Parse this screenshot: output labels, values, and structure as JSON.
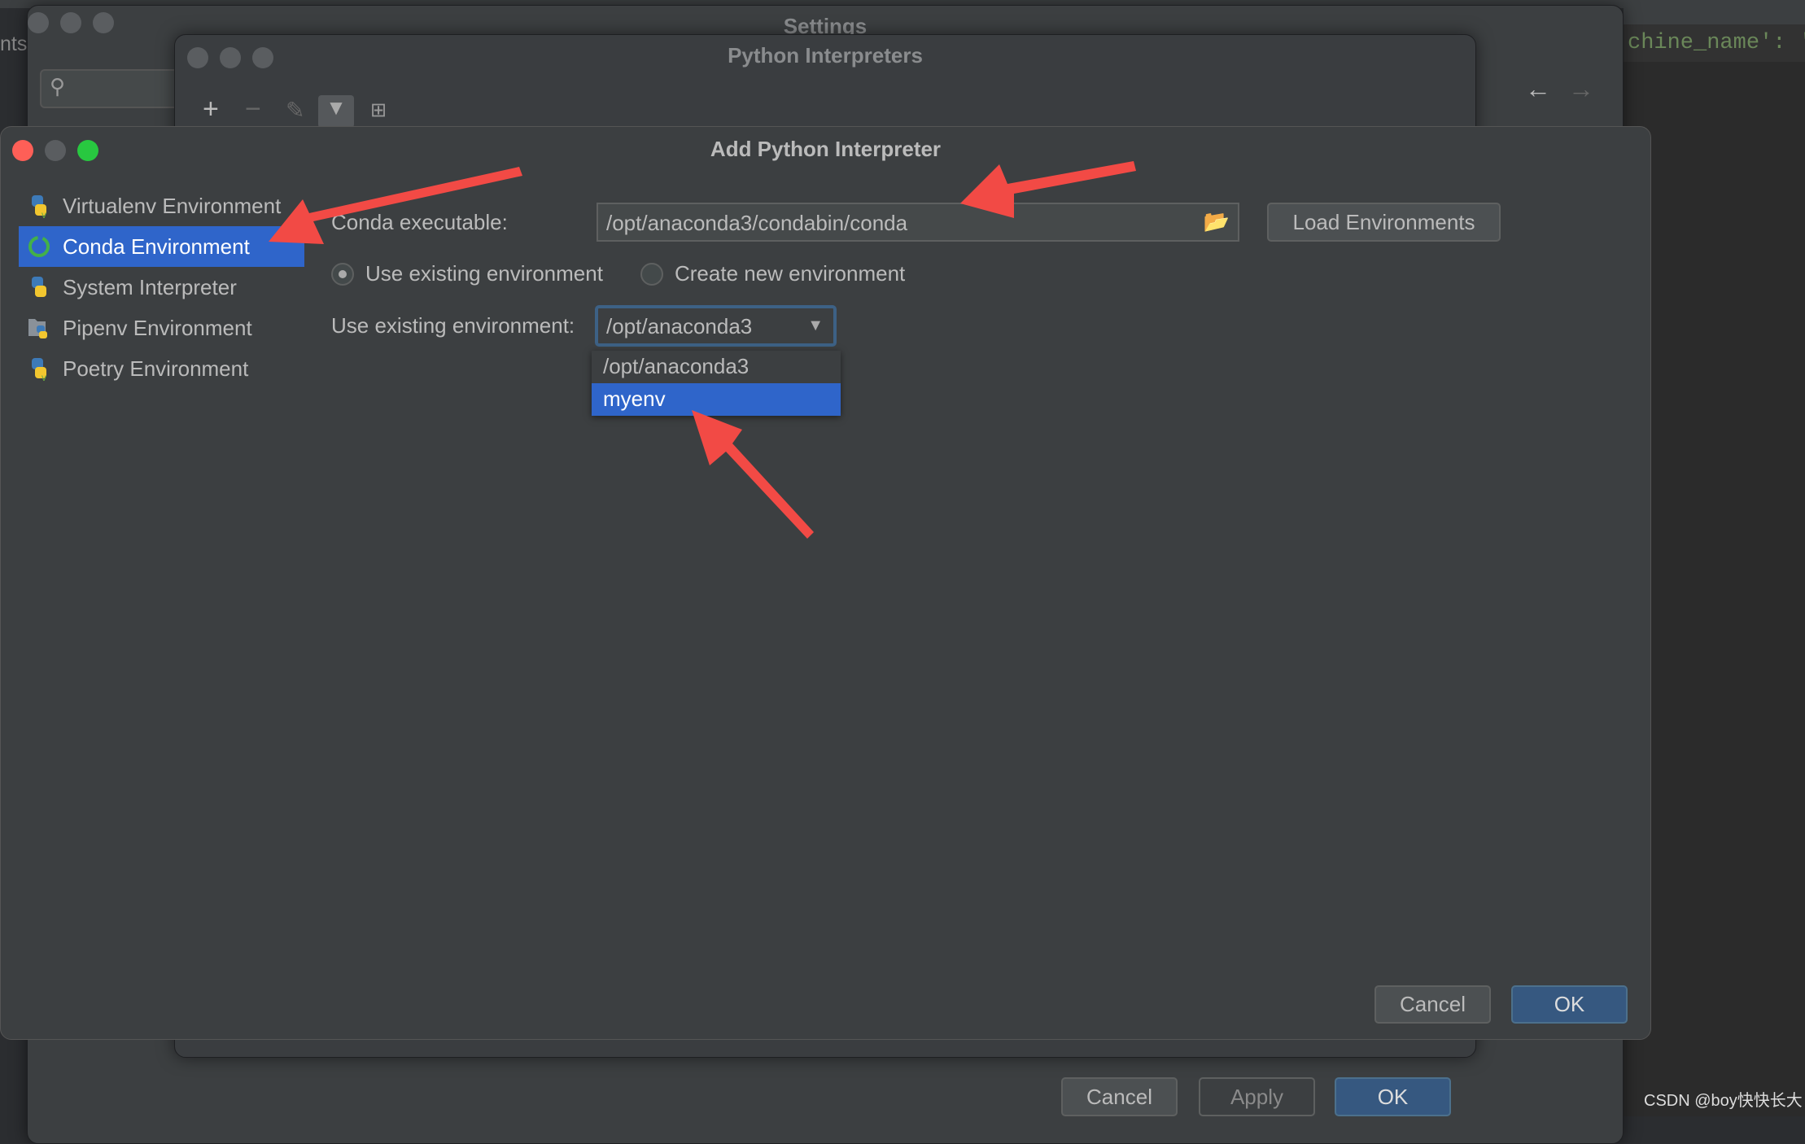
{
  "background": {
    "left_fragment": "nts,",
    "code_fragment": "chine_name': '",
    "watermark": "CSDN @boy快快长大"
  },
  "settings_window": {
    "title": "Settings",
    "buttons": {
      "cancel": "Cancel",
      "apply": "Apply",
      "ok": "OK"
    }
  },
  "python_interpreters_window": {
    "title": "Python Interpreters",
    "toolbar_icons": [
      "plus-icon",
      "minus-icon",
      "pencil-icon",
      "filter-icon",
      "tree-icon"
    ]
  },
  "dialog": {
    "title": "Add Python Interpreter",
    "sidebar": {
      "items": [
        {
          "label": "Virtualenv Environment",
          "icon": "python-virtualenv-icon",
          "selected": false
        },
        {
          "label": "Conda Environment",
          "icon": "conda-icon",
          "selected": true
        },
        {
          "label": "System Interpreter",
          "icon": "python-icon",
          "selected": false
        },
        {
          "label": "Pipenv Environment",
          "icon": "pipenv-icon",
          "selected": false
        },
        {
          "label": "Poetry Environment",
          "icon": "poetry-icon",
          "selected": false
        }
      ]
    },
    "conda_executable_label": "Conda executable:",
    "conda_executable_value": "/opt/anaconda3/condabin/conda",
    "load_environments": "Load Environments",
    "radio_use_existing": "Use existing environment",
    "radio_create_new": "Create new environment",
    "selected_radio": "Use existing environment",
    "existing_env_label": "Use existing environment:",
    "existing_env_value": "/opt/anaconda3",
    "dropdown_options": [
      "/opt/anaconda3",
      "myenv"
    ],
    "highlighted_option": "myenv",
    "cancel": "Cancel",
    "ok": "OK"
  },
  "colors": {
    "accent": "#2f65ca",
    "annotation_arrow": "#f24a45",
    "primary_button": "#365880"
  }
}
